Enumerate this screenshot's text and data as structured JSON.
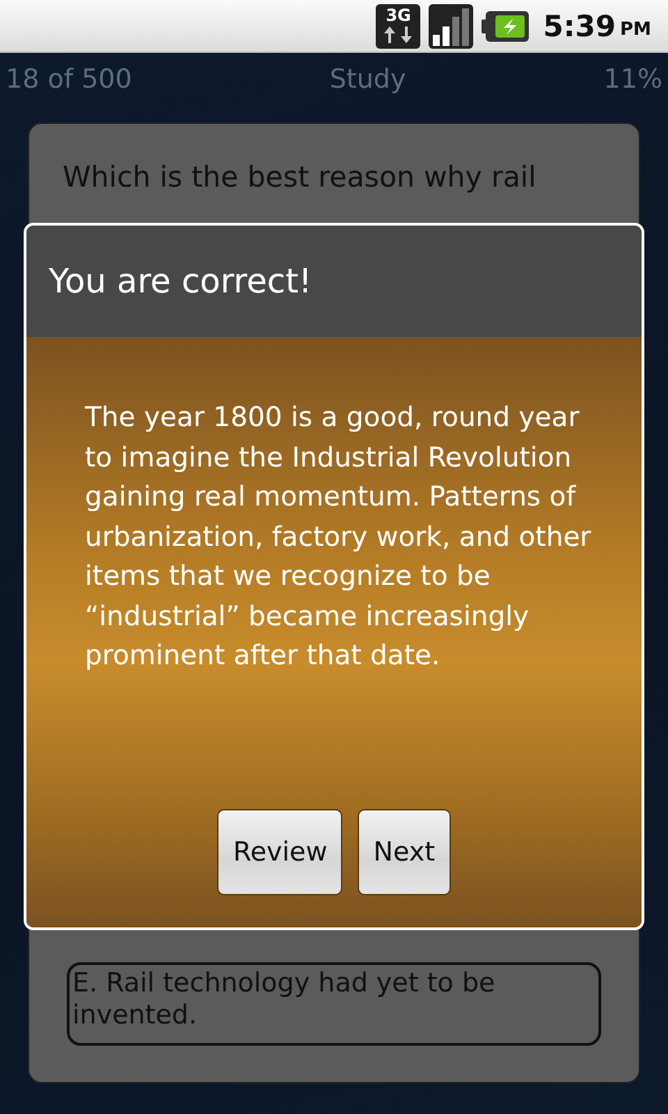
{
  "status_bar": {
    "network": "3G",
    "time": "5:39",
    "meridiem": "PM"
  },
  "header": {
    "progress": "18 of 500",
    "title": "Study",
    "percent": "11%"
  },
  "question": "Which is the best reason why rail",
  "answers": [
    {
      "label": "E. Rail technology had yet to be invented."
    }
  ],
  "dialog": {
    "title": "You are correct!",
    "message": "The year 1800 is a good, round year to imagine the Industrial Revolution gaining real momentum. Patterns of urbanization, factory work, and other items that we recognize to be “industrial” became increasingly prominent after that date.",
    "buttons": [
      "Review",
      "Next"
    ]
  }
}
